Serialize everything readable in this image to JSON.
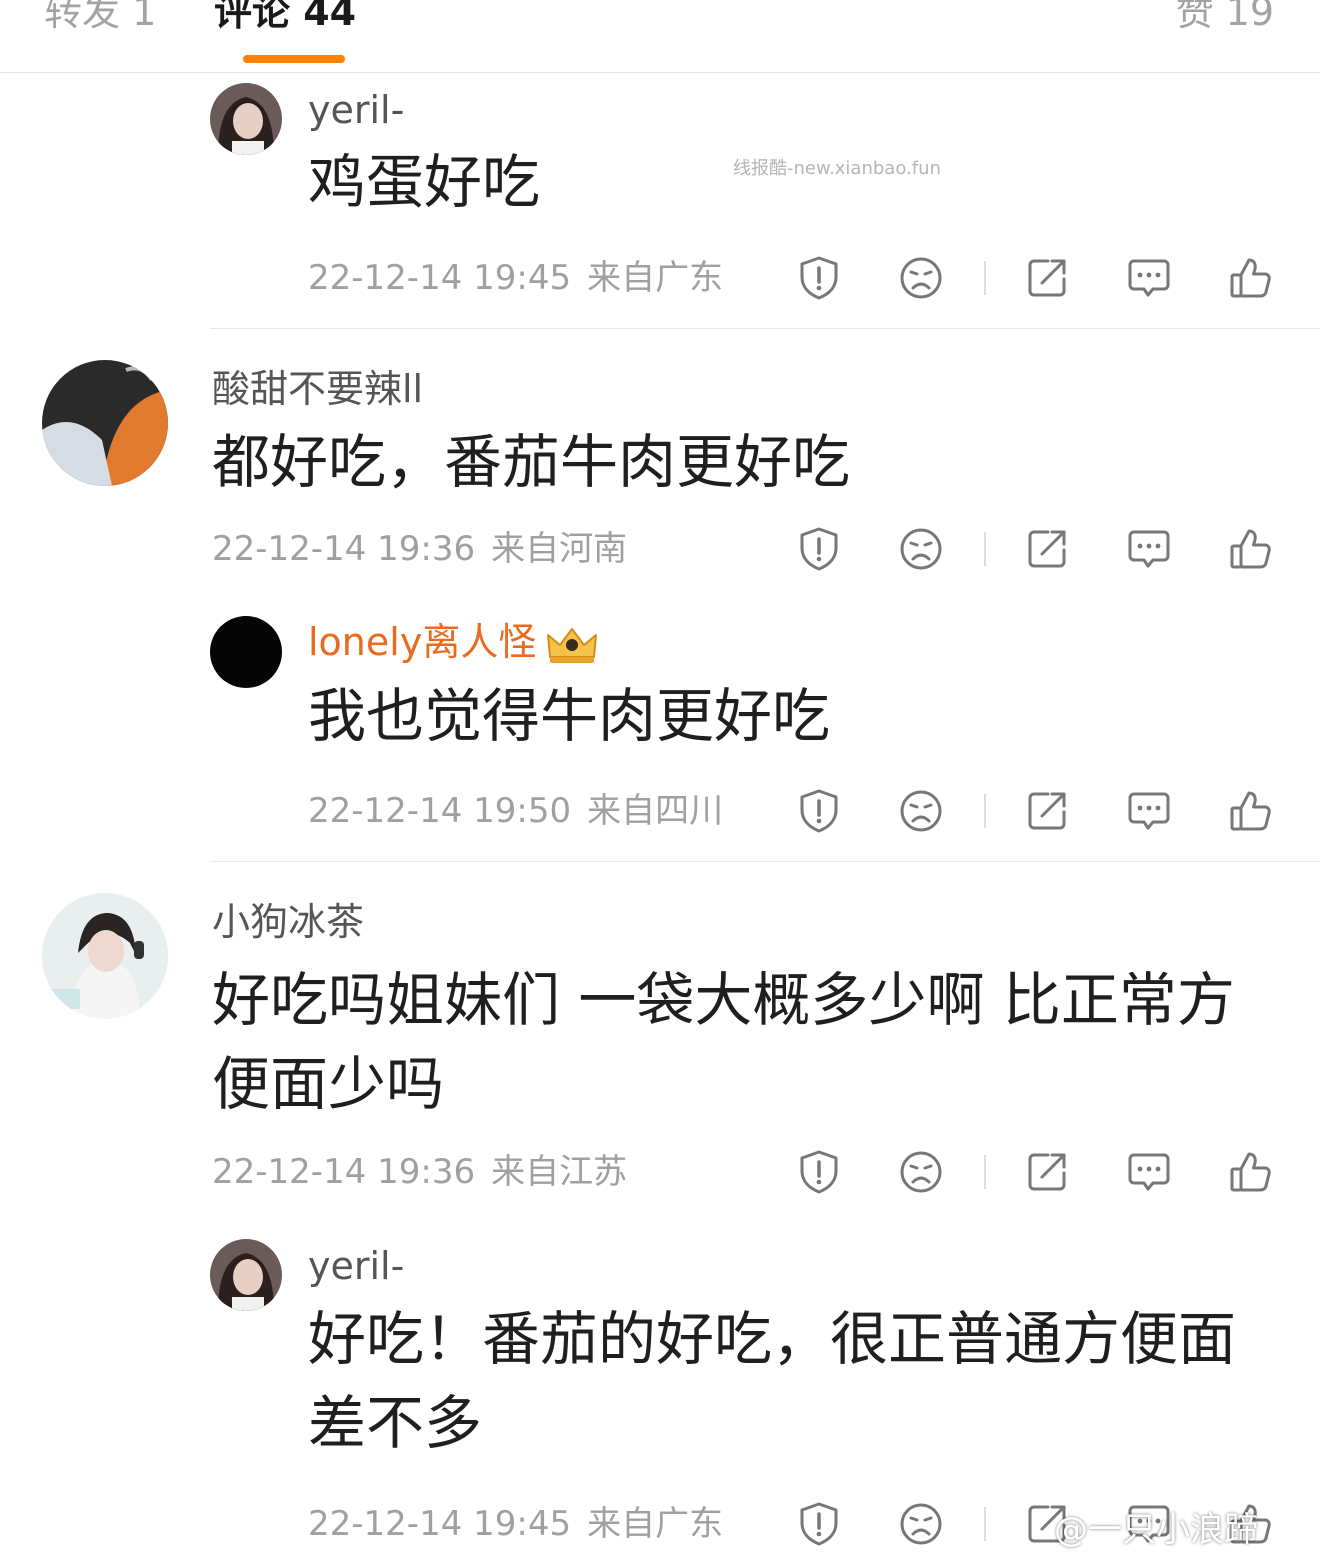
{
  "tabs": {
    "repost": "转发 1",
    "comments": "评论 44",
    "likes": "赞 19"
  },
  "accent_color": "#ff8200",
  "watermark": "线报酷-new.xianbao.fun",
  "bottom_watermark": "@一只小浪蹄",
  "action_icons": [
    "report-icon",
    "dislike-icon",
    "share-icon",
    "reply-icon",
    "like-icon"
  ],
  "comments": [
    {
      "user": "yeril-",
      "text": "鸡蛋好吃",
      "time": "22-12-14 19:45",
      "location": "来自广东"
    },
    {
      "user": "酸甜不要辣ll",
      "text": "都好吃，番茄牛肉更好吃",
      "time": "22-12-14 19:36",
      "location": "来自河南"
    },
    {
      "user": "lonely离人怪",
      "text": "我也觉得牛肉更好吃",
      "time": "22-12-14 19:50",
      "location": "来自四川"
    },
    {
      "user": "小狗冰茶",
      "text": "好吃吗姐妹们 一袋大概多少啊 比正常方便面少吗",
      "time": "22-12-14 19:36",
      "location": "来自江苏"
    },
    {
      "user": "yeril-",
      "text": "好吃！番茄的好吃，很正普通方便面差不多",
      "time": "22-12-14 19:45",
      "location": "来自广东"
    }
  ]
}
